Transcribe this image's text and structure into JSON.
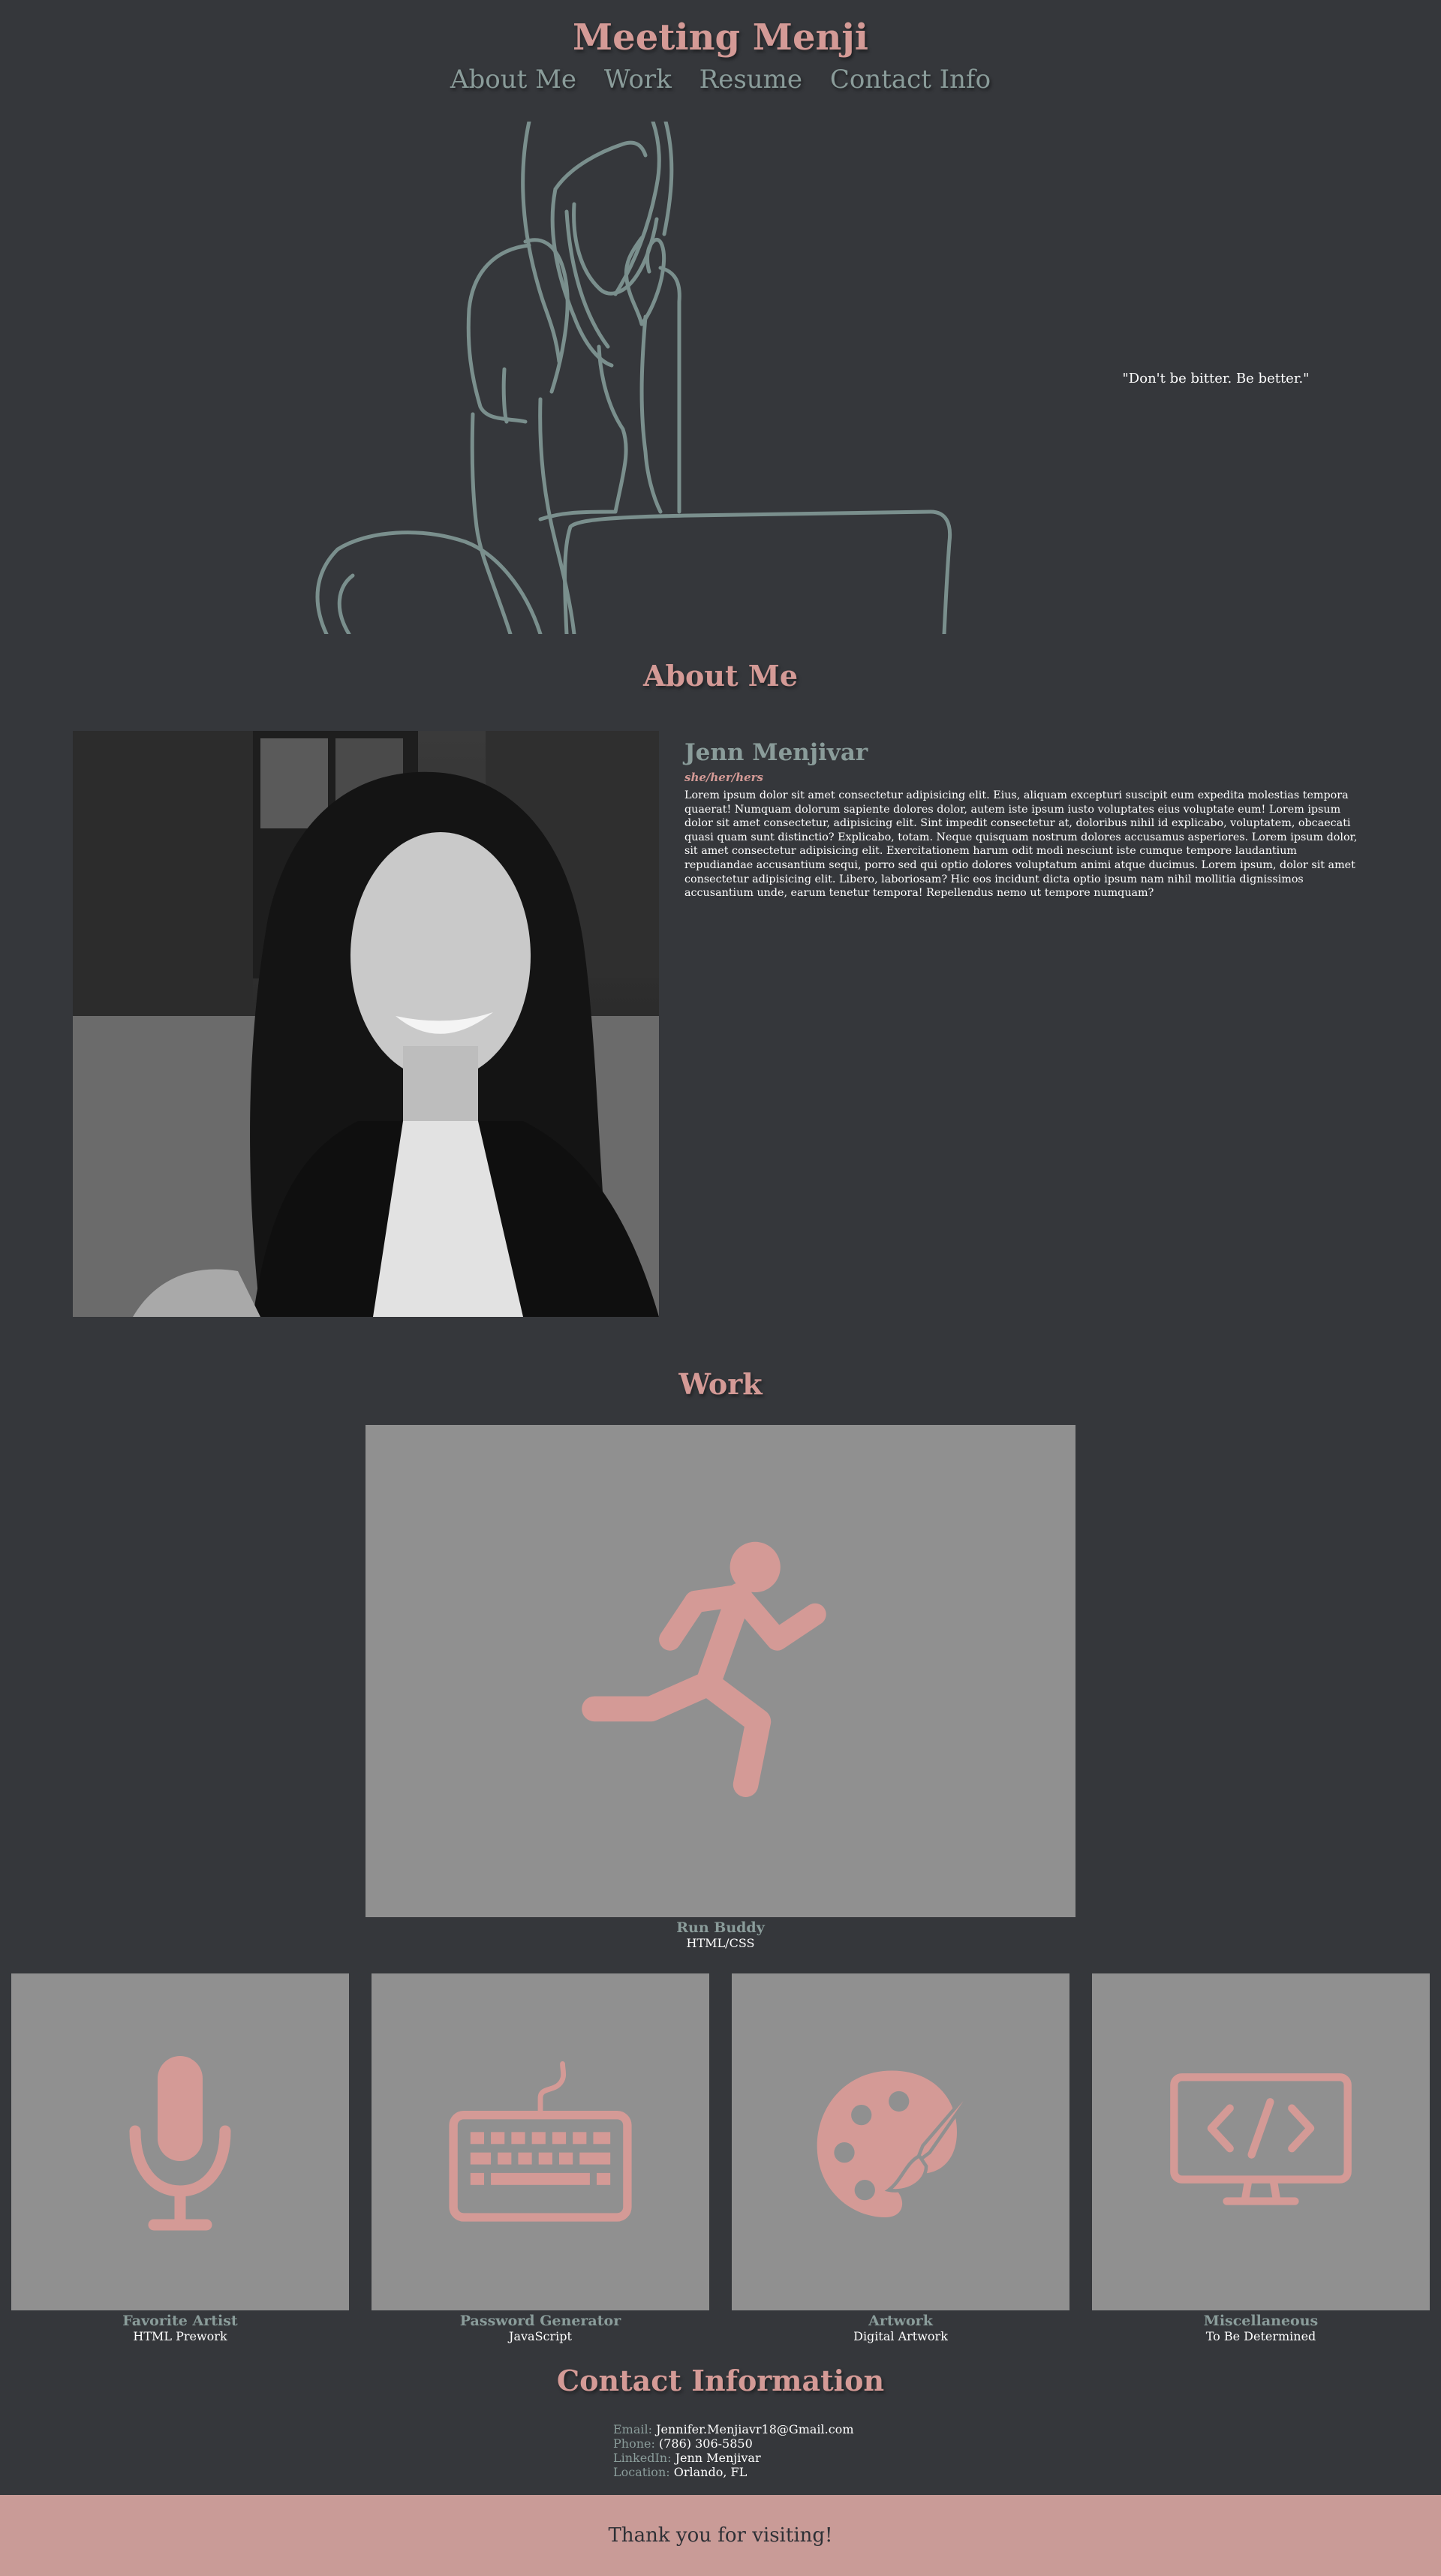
{
  "header": {
    "title": "Meeting Menji",
    "nav": [
      "About Me",
      "Work",
      "Resume",
      "Contact Info"
    ]
  },
  "hero": {
    "quote": "\"Don't be bitter. Be better.\""
  },
  "about": {
    "heading": "About Me",
    "name": "Jenn Menjivar",
    "pronouns": "she/her/hers",
    "bio": "Lorem ipsum dolor sit amet consectetur adipisicing elit. Eius, aliquam excepturi suscipit eum expedita molestias tempora quaerat! Numquam dolorum sapiente dolores dolor, autem iste ipsum iusto voluptates eius voluptate eum! Lorem ipsum dolor sit amet consectetur, adipisicing elit. Sint impedit consectetur at, doloribus nihil id explicabo, voluptatem, obcaecati quasi quam sunt distinctio? Explicabo, totam. Neque quisquam nostrum dolores accusamus asperiores. Lorem ipsum dolor, sit amet consectetur adipisicing elit. Exercitationem harum odit modi nesciunt iste cumque tempore laudantium repudiandae accusantium sequi, porro sed qui optio dolores voluptatum animi atque ducimus. Lorem ipsum, dolor sit amet consectetur adipisicing elit. Libero, laboriosam? Hic eos incidunt dicta optio ipsum nam nihil mollitia dignissimos accusantium unde, earum tenetur tempora! Repellendus nemo ut tempore numquam?"
  },
  "work": {
    "heading": "Work",
    "featured": {
      "title": "Run Buddy",
      "subtitle": "HTML/CSS",
      "icon": "running-person-icon"
    },
    "projects": [
      {
        "title": "Favorite Artist",
        "subtitle": "HTML Prework",
        "icon": "microphone-icon"
      },
      {
        "title": "Password Generator",
        "subtitle": "JavaScript",
        "icon": "keyboard-icon"
      },
      {
        "title": "Artwork",
        "subtitle": "Digital Artwork",
        "icon": "palette-icon"
      },
      {
        "title": "Miscellaneous",
        "subtitle": "To Be Determined",
        "icon": "code-monitor-icon"
      }
    ]
  },
  "contact": {
    "heading": "Contact Information",
    "items": [
      {
        "label": "Email:",
        "value": "Jennifer.Menjiavr18@Gmail.com"
      },
      {
        "label": "Phone:",
        "value": "(786) 306-5850"
      },
      {
        "label": "LinkedIn:",
        "value": "Jenn Menjivar"
      },
      {
        "label": "Location:",
        "value": "Orlando, FL"
      }
    ]
  },
  "footer": {
    "text": "Thank you for visiting!"
  },
  "colors": {
    "background": "#35373b",
    "accent": "#d49a96",
    "muted": "#8a9c9a",
    "card": "#909090",
    "footer": "#c99b97"
  }
}
